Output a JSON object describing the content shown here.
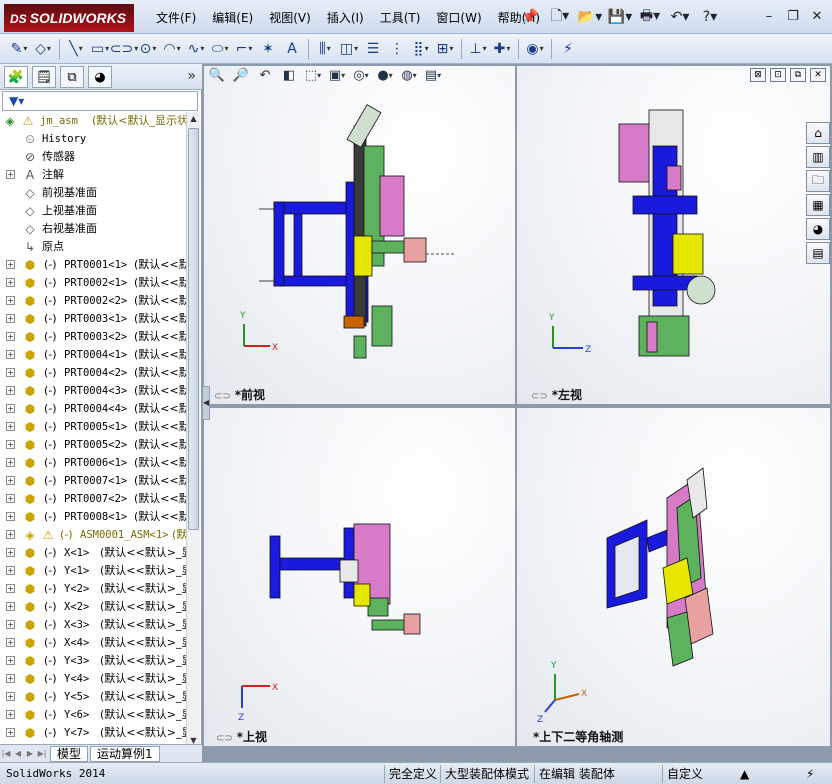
{
  "app": {
    "logo_text": "SOLIDWORKS",
    "logo_ds": "DS"
  },
  "menu": [
    "文件(F)",
    "编辑(E)",
    "视图(V)",
    "插入(I)",
    "工具(T)",
    "窗口(W)",
    "帮助(H)"
  ],
  "quick_access_icons": [
    "pin-icon",
    "new-document-icon",
    "open-folder-icon",
    "save-icon",
    "print-icon",
    "undo-icon",
    "help-icon"
  ],
  "window_buttons": [
    "minimize",
    "restore",
    "close"
  ],
  "command_tools": [
    "sketch-icon",
    "smart-dimension-icon",
    "line-icon",
    "rectangle-icon",
    "slot-icon",
    "circle-icon",
    "arc-icon",
    "spline-icon",
    "ellipse-icon",
    "fillet-icon",
    "offset-icon",
    "point-icon",
    "text-icon",
    "mirror-icon",
    "convert-icon",
    "trim-icon",
    "pattern-icon",
    "move-icon",
    "relation-icon",
    "repair-icon",
    "rapid-sketch-icon",
    "instant2d-icon"
  ],
  "panel_tabs": [
    "feature-manager-tab",
    "property-manager-tab",
    "configuration-manager-tab",
    "appearance-tab"
  ],
  "tree": {
    "root": {
      "name": "jm_asm",
      "config": "(默认<默认_显示状"
    },
    "items": [
      {
        "label": "History",
        "icon": "history-icon",
        "mono": true
      },
      {
        "label": "传感器",
        "icon": "sensor-icon"
      },
      {
        "label": "注解",
        "icon": "annotation-icon",
        "expand": true
      },
      {
        "label": "前视基准面",
        "icon": "plane-icon"
      },
      {
        "label": "上视基准面",
        "icon": "plane-icon"
      },
      {
        "label": "右视基准面",
        "icon": "plane-icon"
      },
      {
        "label": "原点",
        "icon": "origin-icon"
      }
    ],
    "parts": [
      {
        "state": "(-)",
        "name": "PRT0001<1>",
        "config": "(默认<<默"
      },
      {
        "state": "(-)",
        "name": "PRT0002<1>",
        "config": "(默认<<默"
      },
      {
        "state": "(-)",
        "name": "PRT0002<2>",
        "config": "(默认<<默"
      },
      {
        "state": "(-)",
        "name": "PRT0003<1>",
        "config": "(默认<<默"
      },
      {
        "state": "(-)",
        "name": "PRT0003<2>",
        "config": "(默认<<默"
      },
      {
        "state": "(-)",
        "name": "PRT0004<1>",
        "config": "(默认<<默"
      },
      {
        "state": "(-)",
        "name": "PRT0004<2>",
        "config": "(默认<<默"
      },
      {
        "state": "(-)",
        "name": "PRT0004<3>",
        "config": "(默认<<默"
      },
      {
        "state": "(-)",
        "name": "PRT0004<4>",
        "config": "(默认<<默"
      },
      {
        "state": "(-)",
        "name": "PRT0005<1>",
        "config": "(默认<<默"
      },
      {
        "state": "(-)",
        "name": "PRT0005<2>",
        "config": "(默认<<默"
      },
      {
        "state": "(-)",
        "name": "PRT0006<1>",
        "config": "(默认<<默"
      },
      {
        "state": "(-)",
        "name": "PRT0007<1>",
        "config": "(默认<<默"
      },
      {
        "state": "(-)",
        "name": "PRT0007<2>",
        "config": "(默认<<默"
      },
      {
        "state": "(-)",
        "name": "PRT0008<1>",
        "config": "(默认<<默"
      }
    ],
    "subasm": {
      "state": "(-)",
      "name": "ASM0001_ASM<1>",
      "config": "(默"
    },
    "axes": [
      {
        "state": "(-)",
        "name": "X<1>",
        "config": "(默认<<默认>_显"
      },
      {
        "state": "(-)",
        "name": "Y<1>",
        "config": "(默认<<默认>_显"
      },
      {
        "state": "(-)",
        "name": "Y<2>",
        "config": "(默认<<默认>_显"
      },
      {
        "state": "(-)",
        "name": "X<2>",
        "config": "(默认<<默认>_显"
      },
      {
        "state": "(-)",
        "name": "X<3>",
        "config": "(默认<<默认>_显"
      },
      {
        "state": "(-)",
        "name": "X<4>",
        "config": "(默认<<默认>_显"
      },
      {
        "state": "(-)",
        "name": "Y<3>",
        "config": "(默认<<默认>_显"
      },
      {
        "state": "(-)",
        "name": "Y<4>",
        "config": "(默认<<默认>_显"
      },
      {
        "state": "(-)",
        "name": "Y<5>",
        "config": "(默认<<默认>_显"
      },
      {
        "state": "(-)",
        "name": "Y<6>",
        "config": "(默认<<默认>_显"
      },
      {
        "state": "(-)",
        "name": "Y<7>",
        "config": "(默认<<默认>_显"
      }
    ]
  },
  "bottom_tabs": [
    "模型",
    "运动算例1"
  ],
  "view_tools": [
    "zoom-to-fit-icon",
    "zoom-area-icon",
    "previous-view-icon",
    "section-view-icon",
    "view-orientation-icon",
    "display-style-icon",
    "hide-show-icon",
    "appearance-icon",
    "scene-icon",
    "view-settings-icon"
  ],
  "views": [
    {
      "label": "*前视"
    },
    {
      "label": "*左视"
    },
    {
      "label": "*上视"
    },
    {
      "label": "*上下二等角轴测"
    }
  ],
  "axis_labels": {
    "x": "X",
    "y": "Y",
    "z": "Z"
  },
  "task_pane_icons": [
    "solidworks-resources-icon",
    "design-library-icon",
    "file-explorer-icon",
    "view-palette-icon",
    "appearances-icon",
    "custom-properties-icon"
  ],
  "status": {
    "version": "SolidWorks 2014",
    "cells": [
      "完全定义",
      "大型装配体模式",
      "在编辑 装配体",
      "自定义"
    ]
  },
  "colors": {
    "assembly_blue": "#1a1adc",
    "part_green": "#5db35d",
    "part_pink": "#d77ac8",
    "part_yellow": "#e6e600"
  }
}
